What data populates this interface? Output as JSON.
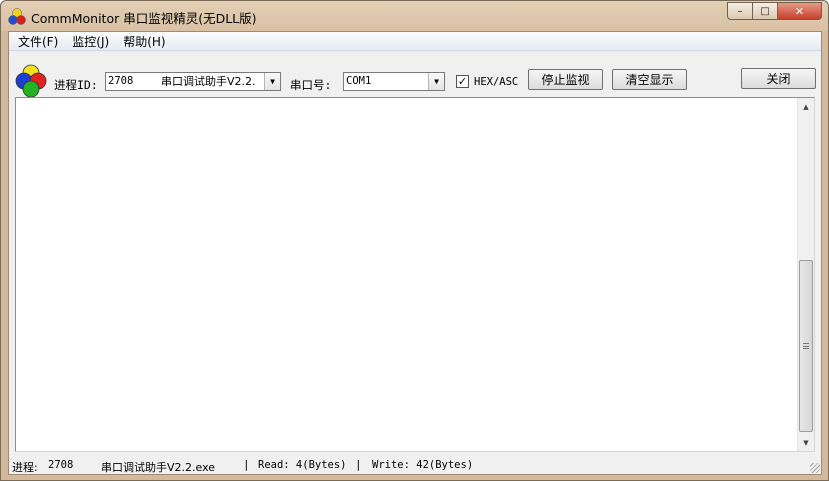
{
  "window": {
    "title": "CommMonitor 串口监视精灵(无DLL版)",
    "controls": {
      "minimize": "–",
      "maximize": "□",
      "close": "✕"
    }
  },
  "menu": [
    {
      "label": "文件(F)"
    },
    {
      "label": "监控(J)"
    },
    {
      "label": "帮助(H)"
    }
  ],
  "toolbar": {
    "process_label": "进程ID:",
    "process_id": "2708",
    "process_name": "串口调试助手V2.2.",
    "port_label": "串口号:",
    "port_value": "COM1",
    "hex_asc_label": "HEX/ASC",
    "hex_asc_checked": "✓",
    "stop_button": "停止监视",
    "clear_button": "清空显示",
    "close_button": "关闭"
  },
  "scrollbar": {
    "up": "▲",
    "down": "▼"
  },
  "statusbar": {
    "process_label": "进程:",
    "process_id": "2708",
    "process_name": "串口调试助手V2.2.exe",
    "sep": "|",
    "read": "Read: 4(Bytes)",
    "write": "Write: 42(Bytes)"
  },
  "colors": {
    "frame": "#d4b99a",
    "client": "#f0f0f0",
    "close_button": "#c4402a"
  },
  "icons": {
    "app": "rgb-circles-icon",
    "logo": "four-color-circles-icon",
    "dropdown": "triangle-down-icon"
  }
}
